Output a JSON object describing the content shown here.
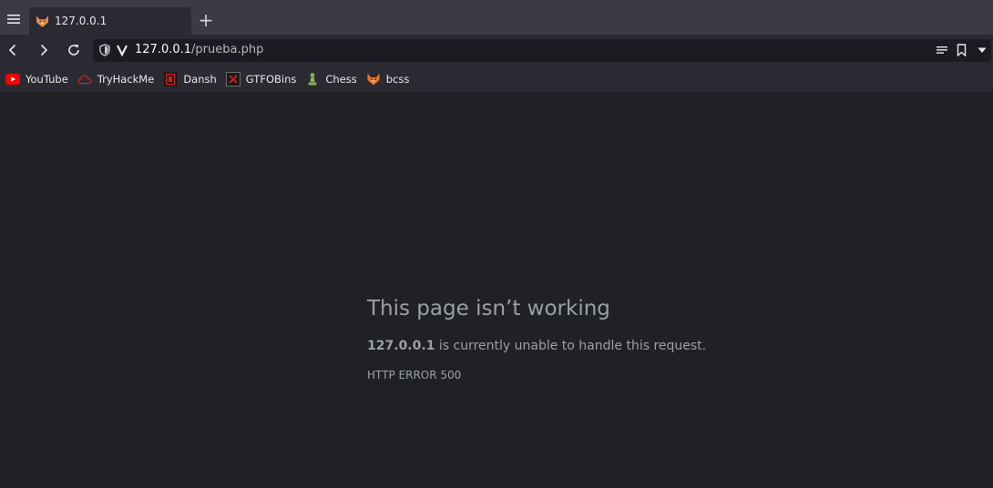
{
  "colors": {
    "tabbar_bg": "#3b3b45",
    "toolbar_bg": "#2b2a33",
    "urlbar_bg": "#1c1b22",
    "content_bg": "#202124",
    "error_text": "#9aa0a6"
  },
  "tab": {
    "title": "127.0.0.1",
    "favicon": "fox-icon"
  },
  "newtab": {
    "label": "+"
  },
  "urlbar": {
    "host": "127.0.0.1",
    "path": "/prueba.php"
  },
  "bookmarks": [
    {
      "label": "YouTube",
      "icon": "youtube-icon"
    },
    {
      "label": "TryHackMe",
      "icon": "tryhackme-icon"
    },
    {
      "label": "Dansh",
      "icon": "dansh-icon"
    },
    {
      "label": "GTFOBins",
      "icon": "gtfobins-icon"
    },
    {
      "label": "Chess",
      "icon": "chess-pawn-icon"
    },
    {
      "label": "bcss",
      "icon": "fox-icon"
    }
  ],
  "error": {
    "title": "This page isn’t working",
    "host": "127.0.0.1",
    "message": " is currently unable to handle this request.",
    "code": "HTTP ERROR 500"
  }
}
